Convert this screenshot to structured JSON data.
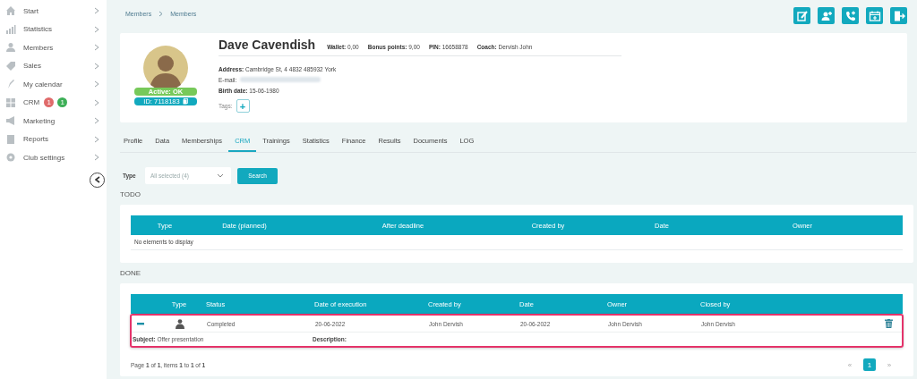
{
  "sidebar": {
    "items": [
      {
        "label": "Start"
      },
      {
        "label": "Statistics"
      },
      {
        "label": "Members"
      },
      {
        "label": "Sales"
      },
      {
        "label": "My calendar"
      },
      {
        "label": "CRM",
        "badges": [
          {
            "text": "1",
            "color": "#e06b6b"
          },
          {
            "text": "1",
            "color": "#3daf57"
          }
        ]
      },
      {
        "label": "Marketing"
      },
      {
        "label": "Reports"
      },
      {
        "label": "Club settings"
      }
    ]
  },
  "breadcrumb": [
    "Members",
    "Members"
  ],
  "profile": {
    "name": "Dave Cavendish",
    "stats": [
      {
        "label": "Wallet:",
        "value": "0,00"
      },
      {
        "label": "Bonus points:",
        "value": "9,00"
      },
      {
        "label": "PIN:",
        "value": "16658878"
      },
      {
        "label": "Coach:",
        "value": "Dervish John"
      }
    ],
    "status_badge": "Active: OK",
    "id_badge": "ID: 7118183",
    "details": [
      {
        "label": "Address:",
        "value": "Cambridge St, 4 4832 485932 York"
      },
      {
        "label": "E-mail:",
        "blurred": true
      },
      {
        "label": "Birth date:",
        "value": "15-06-1980"
      }
    ],
    "tags_label": "Tags:",
    "add_tag": "+"
  },
  "tabs": [
    {
      "label": "Profile",
      "selected": false
    },
    {
      "label": "Data",
      "selected": false
    },
    {
      "label": "Memberships",
      "selected": false
    },
    {
      "label": "CRM",
      "selected": true
    },
    {
      "label": "Trainings",
      "selected": false
    },
    {
      "label": "Statistics",
      "selected": false
    },
    {
      "label": "Finance",
      "selected": false
    },
    {
      "label": "Results",
      "selected": false
    },
    {
      "label": "Documents",
      "selected": false
    },
    {
      "label": "LOG",
      "selected": false
    }
  ],
  "filter": {
    "label": "Type",
    "placeholder": "All selected (4)",
    "button": "Search"
  },
  "todo": {
    "title": "TODO",
    "columns": [
      "Type",
      "Date (planned)",
      "After deadline",
      "Created by",
      "Date",
      "Owner"
    ],
    "empty": "No elements to display"
  },
  "done": {
    "title": "DONE",
    "columns": [
      "Type",
      "Status",
      "Date of execution",
      "Created by",
      "Date",
      "Owner",
      "Closed by"
    ],
    "rows": [
      {
        "expanded": true,
        "highlighted": true,
        "status": "Completed",
        "date_of_execution": "20-06-2022",
        "created_by": "John Dervish",
        "date": "20-06-2022",
        "owner": "John Dervish",
        "closed_by": "John Dervish",
        "subject": "**Subject:** Offer presentation",
        "description_label": "Description:"
      }
    ],
    "footer": "Page **1** of **1**, items **1** to **1** of **1**",
    "pages": [
      {
        "label": "«",
        "selected": false
      },
      {
        "label": "1",
        "selected": true
      },
      {
        "label": "»",
        "selected": false
      }
    ]
  }
}
